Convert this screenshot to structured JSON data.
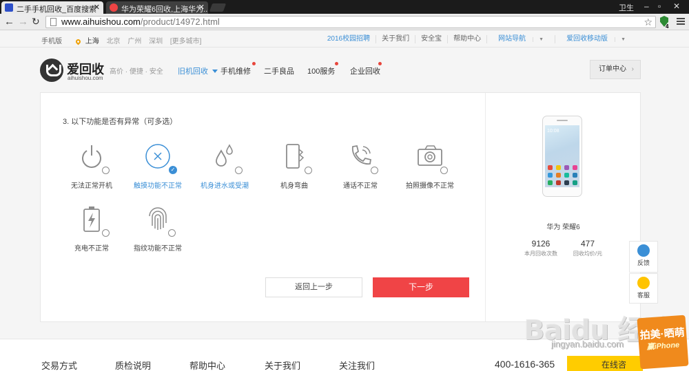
{
  "browser": {
    "tabs": [
      {
        "title": "二手手机回收_百度搜索"
      },
      {
        "title": "华为荣耀6回收,上海华为..."
      }
    ],
    "window_label": "卫生",
    "url_domain": "www.aihuishou.com",
    "url_path": "/product/14972.html",
    "extension_badge": "4"
  },
  "topbar": {
    "mobile": "手机版",
    "cities": [
      "上海",
      "北京",
      "广州",
      "深圳"
    ],
    "more_cities": "[更多城市]",
    "links": [
      "2016校园招聘",
      "关于我们",
      "安全宝",
      "帮助中心",
      "网站导航",
      "爱回收移动版"
    ]
  },
  "header": {
    "logo_name": "爱回收",
    "logo_domain": "aihuishou.com",
    "slogan": "高价 · 便捷 · 安全",
    "nav": [
      "旧机回收",
      "手机维修",
      "二手良品",
      "100服务",
      "企业回收"
    ],
    "order_center": "订单中心"
  },
  "question": {
    "title": "3. 以下功能是否有异常（可多选）",
    "options": [
      {
        "label": "无法正常开机",
        "icon": "power-icon",
        "selected": false
      },
      {
        "label": "触摸功能不正常",
        "icon": "touch-icon",
        "selected": true
      },
      {
        "label": "机身进水或受潮",
        "icon": "water-drop-icon",
        "selected": false
      },
      {
        "label": "机身弯曲",
        "icon": "bent-phone-icon",
        "selected": false
      },
      {
        "label": "通话不正常",
        "icon": "phone-call-icon",
        "selected": false
      },
      {
        "label": "拍照摄像不正常",
        "icon": "camera-icon",
        "selected": false
      },
      {
        "label": "充电不正常",
        "icon": "battery-icon",
        "selected": false
      },
      {
        "label": "指纹功能不正常",
        "icon": "fingerprint-icon",
        "selected": false
      }
    ],
    "back_label": "返回上一步",
    "next_label": "下一步"
  },
  "product": {
    "name": "华为 荣耀6",
    "phone_time": "10:08",
    "recycle_count": "9126",
    "recycle_count_label": "本月回收次数",
    "avg_price": "477",
    "avg_price_label": "回收均价/元"
  },
  "float_buttons": [
    {
      "label": "反馈",
      "icon": "feedback-icon"
    },
    {
      "label": "客服",
      "icon": "customer-service-icon"
    }
  ],
  "footer": {
    "items": [
      "交易方式",
      "质检说明",
      "帮助中心",
      "关于我们",
      "关注我们"
    ],
    "phone": "400-1616-365",
    "online_label": "在线咨"
  },
  "watermark": {
    "text": "Baidu 经验",
    "url": "jingyan.baidu.com",
    "promo_line1": "拍美·晒萌",
    "promo_line2": "赢iPhone"
  },
  "colors": {
    "accent_blue": "#3b8fd6",
    "brand_red": "#f04446",
    "dot_red": "#e7453b"
  }
}
